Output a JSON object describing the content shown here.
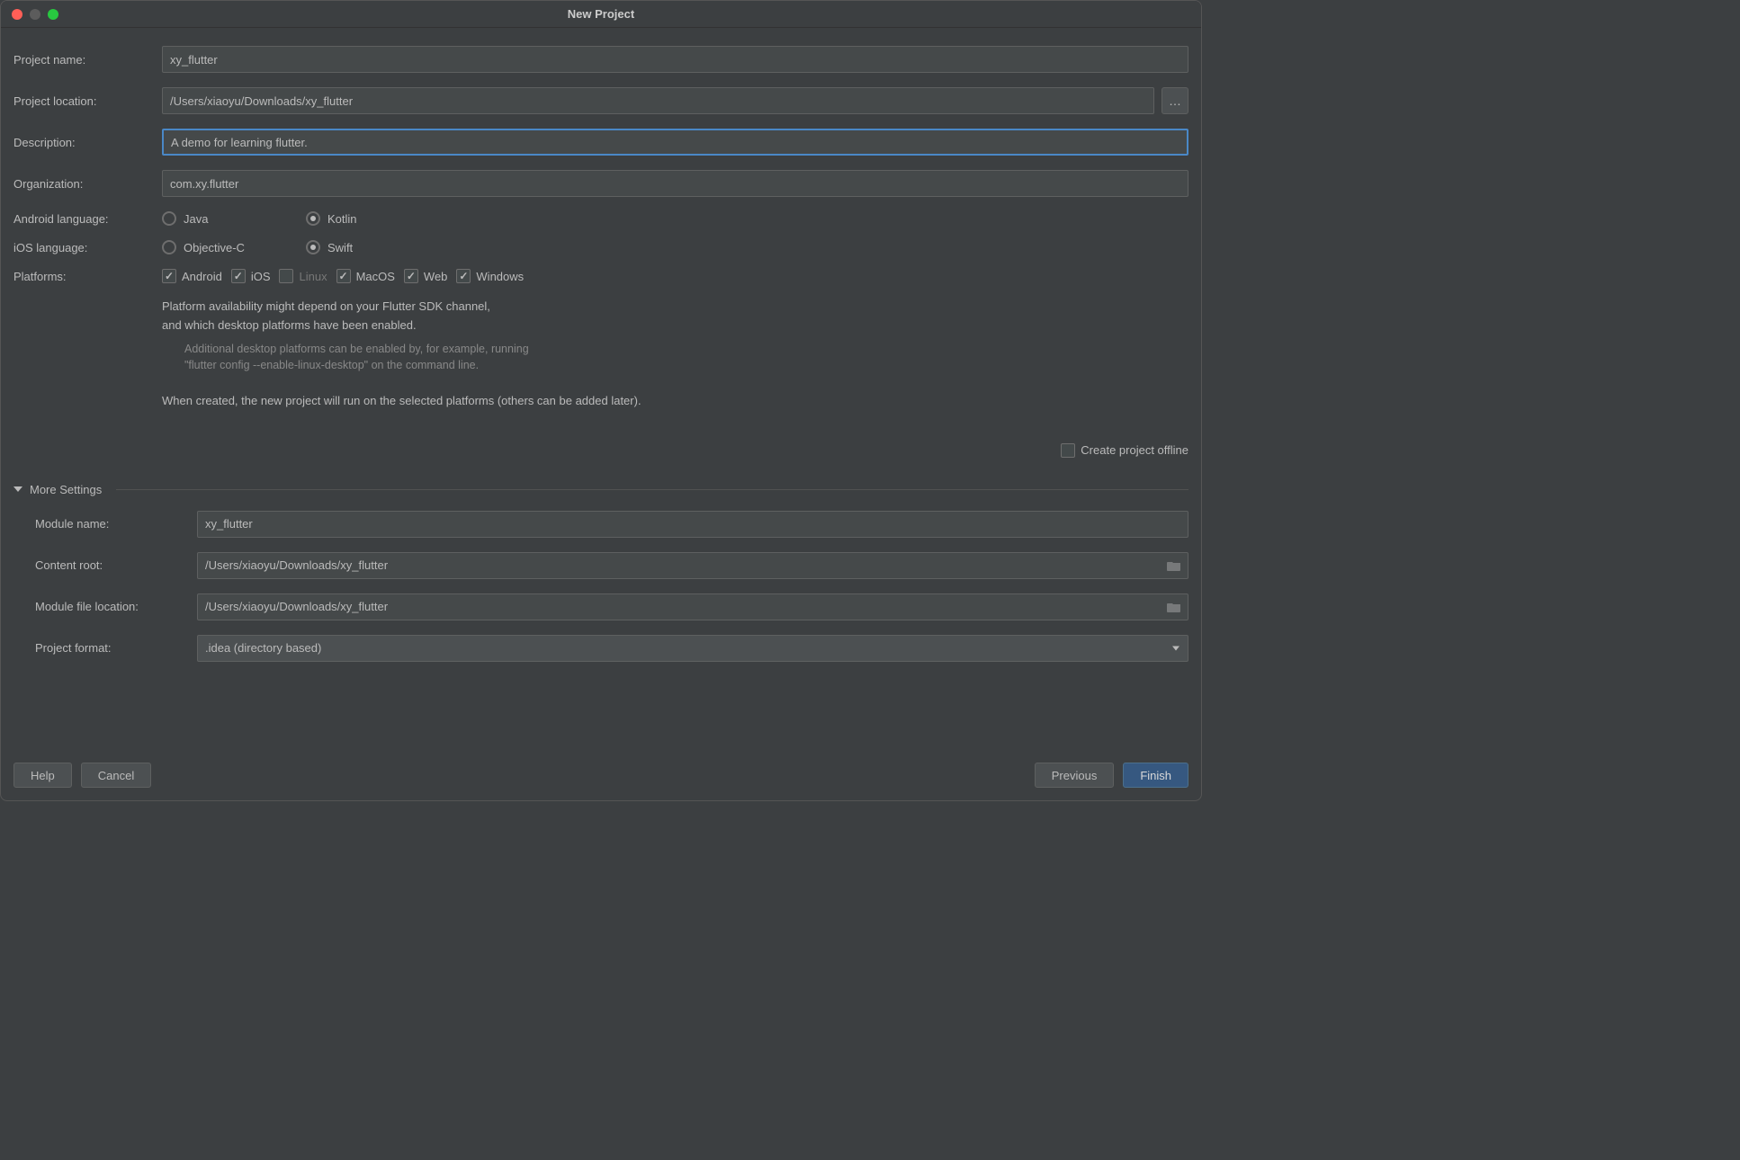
{
  "window": {
    "title": "New Project"
  },
  "form": {
    "project_name_label": "Project name:",
    "project_name_value": "xy_flutter",
    "project_location_label": "Project location:",
    "project_location_value": "/Users/xiaoyu/Downloads/xy_flutter",
    "description_label": "Description:",
    "description_value": "A demo for learning flutter.",
    "organization_label": "Organization:",
    "organization_value": "com.xy.flutter",
    "android_lang_label": "Android language:",
    "android_lang_options": {
      "java": "Java",
      "kotlin": "Kotlin"
    },
    "android_lang_selected": "kotlin",
    "ios_lang_label": "iOS language:",
    "ios_lang_options": {
      "objc": "Objective-C",
      "swift": "Swift"
    },
    "ios_lang_selected": "swift",
    "platforms_label": "Platforms:",
    "platforms": [
      {
        "label": "Android",
        "checked": true,
        "disabled": false
      },
      {
        "label": "iOS",
        "checked": true,
        "disabled": false
      },
      {
        "label": "Linux",
        "checked": false,
        "disabled": true
      },
      {
        "label": "MacOS",
        "checked": true,
        "disabled": false
      },
      {
        "label": "Web",
        "checked": true,
        "disabled": false
      },
      {
        "label": "Windows",
        "checked": true,
        "disabled": false
      }
    ],
    "platform_info1": "Platform availability might depend on your Flutter SDK channel,\nand which desktop platforms have been enabled.",
    "platform_info2": "Additional desktop platforms can be enabled by, for example, running\n\"flutter config --enable-linux-desktop\" on the command line.",
    "platform_info3": "When created, the new project will run on the selected platforms (others can be added later).",
    "create_offline_label": "Create project offline",
    "create_offline_checked": false
  },
  "more": {
    "header": "More Settings",
    "module_name_label": "Module name:",
    "module_name_value": "xy_flutter",
    "content_root_label": "Content root:",
    "content_root_value": "/Users/xiaoyu/Downloads/xy_flutter",
    "module_file_loc_label": "Module file location:",
    "module_file_loc_value": "/Users/xiaoyu/Downloads/xy_flutter",
    "project_format_label": "Project format:",
    "project_format_value": ".idea (directory based)"
  },
  "buttons": {
    "help": "Help",
    "cancel": "Cancel",
    "previous": "Previous",
    "finish": "Finish"
  }
}
